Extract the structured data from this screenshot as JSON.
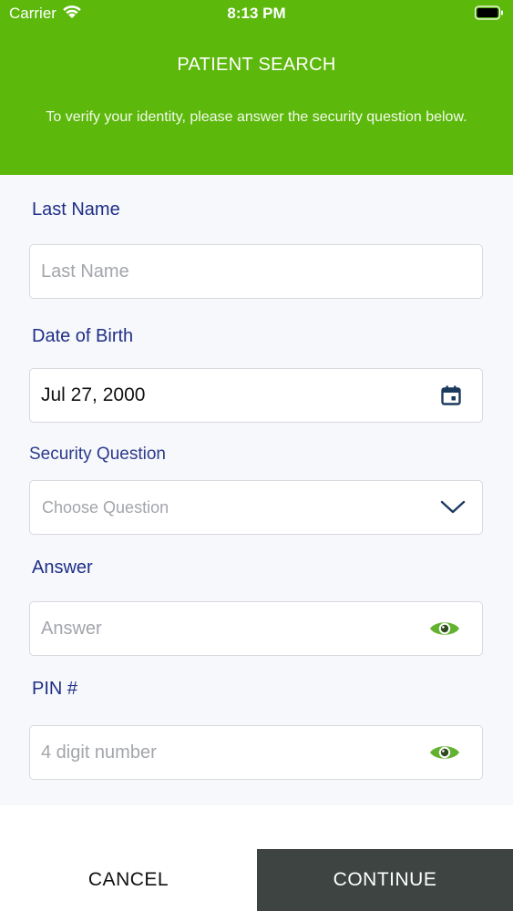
{
  "status_bar": {
    "carrier": "Carrier",
    "time": "8:13 PM",
    "wifi_icon": "wifi-icon",
    "battery_icon": "battery-icon"
  },
  "header": {
    "title": "PATIENT SEARCH",
    "subtitle": "To verify your identity, please answer the security question below.",
    "background_color": "#5cb80b"
  },
  "form": {
    "last_name": {
      "label": "Last Name",
      "placeholder": "Last Name",
      "value": ""
    },
    "date_of_birth": {
      "label": "Date of Birth",
      "value": "Jul 27, 2000",
      "icon": "calendar-icon"
    },
    "security_question": {
      "label": "Security Question",
      "placeholder": "Choose Question",
      "icon": "chevron-down-icon"
    },
    "answer": {
      "label": "Answer",
      "placeholder": "Answer",
      "icon": "eye-icon"
    },
    "pin": {
      "label": "PIN #",
      "placeholder": "4 digit number",
      "icon": "eye-icon"
    }
  },
  "footer": {
    "cancel_label": "CANCEL",
    "continue_label": "CONTINUE"
  },
  "colors": {
    "accent_green": "#5cb80b",
    "label_blue": "#1f2f87",
    "continue_bg": "#3e4441",
    "eye_green": "#62b22f"
  }
}
